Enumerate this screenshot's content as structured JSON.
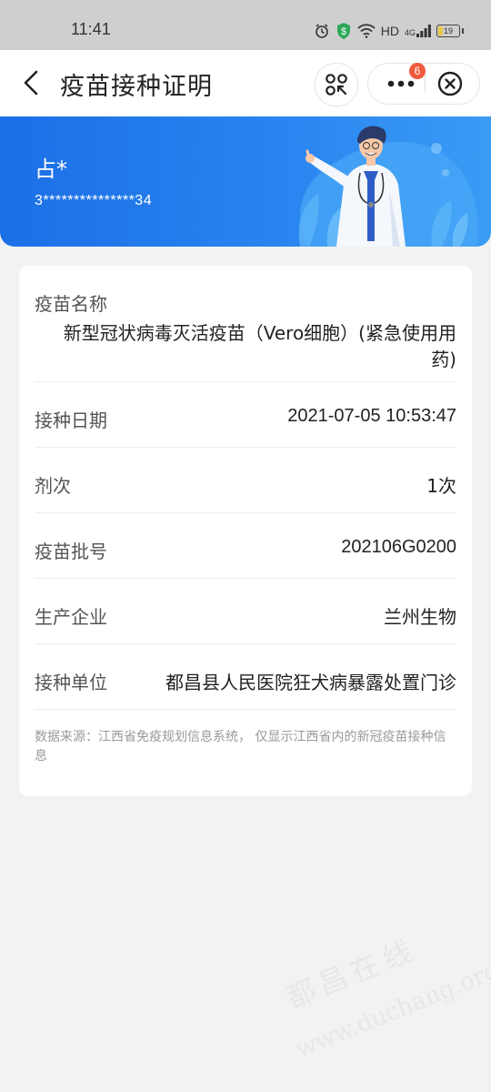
{
  "status_bar": {
    "time": "11:41",
    "network": "HD",
    "signal": "4G",
    "battery": "19",
    "icons": [
      "alarm-icon",
      "shield-dollar-icon",
      "wifi-icon",
      "hd-icon",
      "signal-icon",
      "battery-icon"
    ]
  },
  "nav": {
    "title": "疫苗接种证明",
    "badge_count": "6",
    "icons": [
      "back-icon",
      "scan-icon",
      "more-icon",
      "close-icon"
    ]
  },
  "header": {
    "name": "占*",
    "id_number": "3***************34"
  },
  "record": {
    "vaccine_name_label": "疫苗名称",
    "vaccine_name_value": "新型冠状病毒灭活疫苗（Vero细胞）(紧急使用用药)",
    "date_label": "接种日期",
    "date_value": "2021-07-05 10:53:47",
    "dose_label": "剂次",
    "dose_value": "1次",
    "batch_label": "疫苗批号",
    "batch_value": "202106G0200",
    "manufacturer_label": "生产企业",
    "manufacturer_value": "兰州生物",
    "site_label": "接种单位",
    "site_value": "都昌县人民医院狂犬病暴露处置门诊",
    "source_note": "数据来源：江西省免疫规划信息系统， 仅显示江西省内的新冠疫苗接种信息"
  },
  "watermark": {
    "line1": "都昌在线",
    "line2": "www.duchang.org"
  },
  "colors": {
    "hero_blue": "#2a86f0",
    "badge_red": "#f05a3c",
    "background": "#f2f2f2"
  }
}
